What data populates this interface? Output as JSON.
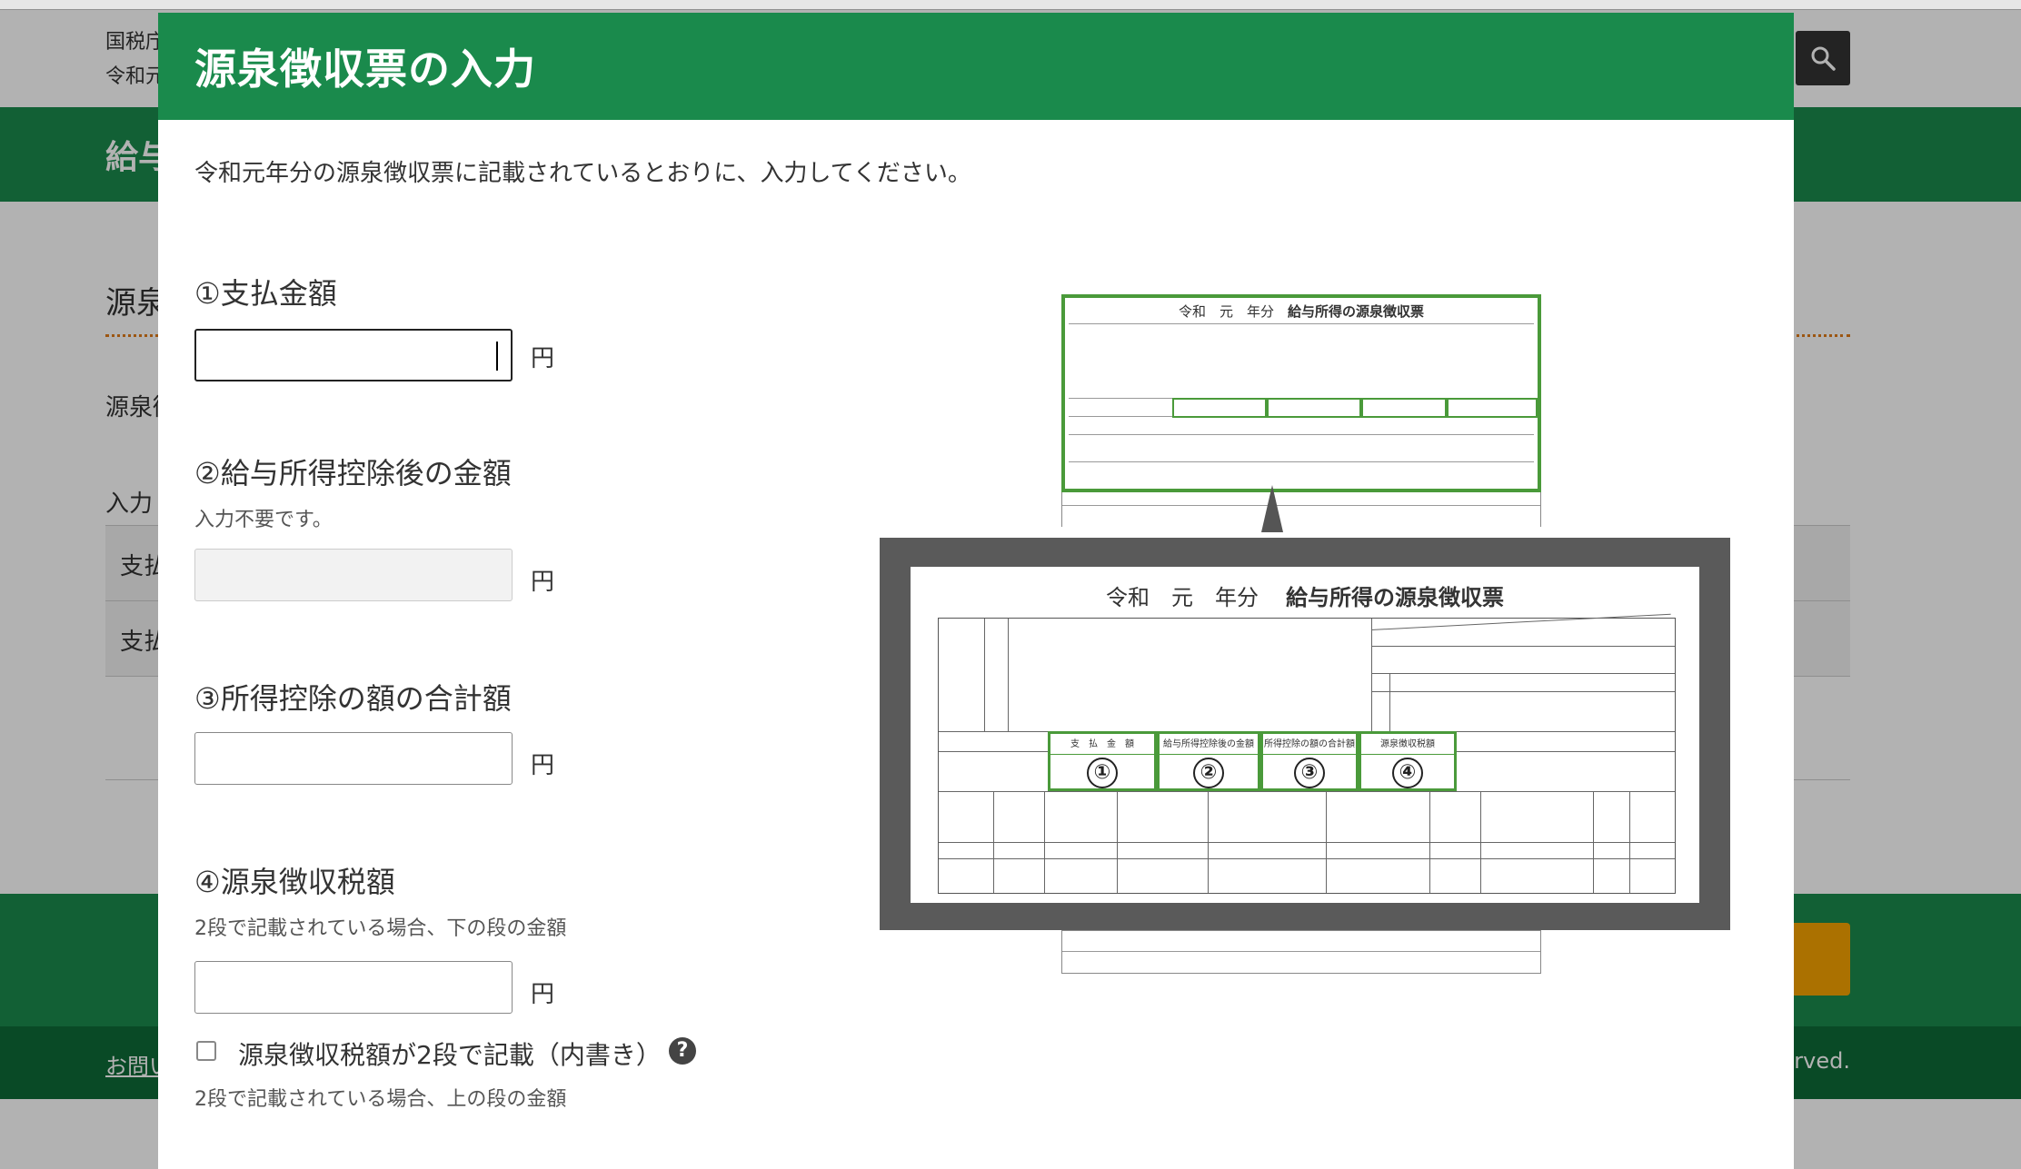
{
  "background": {
    "header_line1": "国税庁",
    "header_line2": "令和元",
    "green_band_title": "給与",
    "section_title": "源泉",
    "section_text": "源泉徴",
    "input_heading": "入力",
    "table_rows": [
      "支払",
      "支払"
    ],
    "footer_link": "お問い",
    "footer_copy": "rved.",
    "search_icon": "search-icon"
  },
  "modal": {
    "title": "源泉徴収票の入力",
    "intro": "令和元年分の源泉徴収票に記載されているとおりに、入力してください。",
    "fields": [
      {
        "label": "①支払金額",
        "note": "",
        "value": "",
        "unit": "円",
        "state": "focused"
      },
      {
        "label": "②給与所得控除後の金額",
        "note": "入力不要です。",
        "value": "",
        "unit": "円",
        "state": "disabled"
      },
      {
        "label": "③所得控除の額の合計額",
        "note": "",
        "value": "",
        "unit": "円",
        "state": "normal"
      },
      {
        "label": "④源泉徴収税額",
        "note": "2段で記載されている場合、下の段の金額",
        "value": "",
        "unit": "円",
        "state": "normal"
      }
    ],
    "checkbox": {
      "label": "源泉徴収税額が2段で記載（内書き）",
      "checked": false,
      "note": "2段で記載されている場合、上の段の金額",
      "help_icon": "?"
    }
  },
  "illustration": {
    "era": "令和　元　年分",
    "doc_title": "給与所得の源泉徴収票",
    "numbered_cells": [
      {
        "num": "①",
        "caption": "支　払　金　額"
      },
      {
        "num": "②",
        "caption": "給与所得控除後の金額"
      },
      {
        "num": "③",
        "caption": "所得控除の額の合計額"
      },
      {
        "num": "④",
        "caption": "源泉徴収税額"
      }
    ],
    "highlight_color": "#4a9a3a"
  },
  "colors": {
    "header_green": "#1a8a4c",
    "footer_dark_green": "#0e6a37",
    "accent_orange": "#f5a300"
  }
}
